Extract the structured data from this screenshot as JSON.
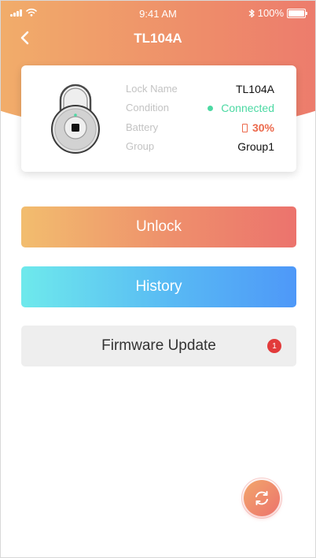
{
  "status_bar": {
    "time": "9:41 AM",
    "battery": "100%"
  },
  "nav": {
    "title": "TL104A",
    "back_icon": "chevron-left-icon"
  },
  "lock_card": {
    "rows": [
      {
        "label": "Lock Name",
        "value": "TL104A"
      },
      {
        "label": "Condition",
        "value": "Connected"
      },
      {
        "label": "Battery",
        "value": "30%"
      },
      {
        "label": "Group",
        "value": "Group1"
      }
    ]
  },
  "actions": {
    "unlock_label": "Unlock",
    "history_label": "History",
    "firmware_label": "Firmware Update",
    "firmware_badge": "1"
  },
  "fab": {
    "icon": "refresh-icon"
  },
  "colors": {
    "header_start": "#f2b46a",
    "header_end": "#ec756d",
    "connected": "#4cd9a3",
    "battery_warning": "#ec6a4d",
    "history_start": "#6ee9ec",
    "history_end": "#4e98f8",
    "badge": "#e23b3b"
  }
}
